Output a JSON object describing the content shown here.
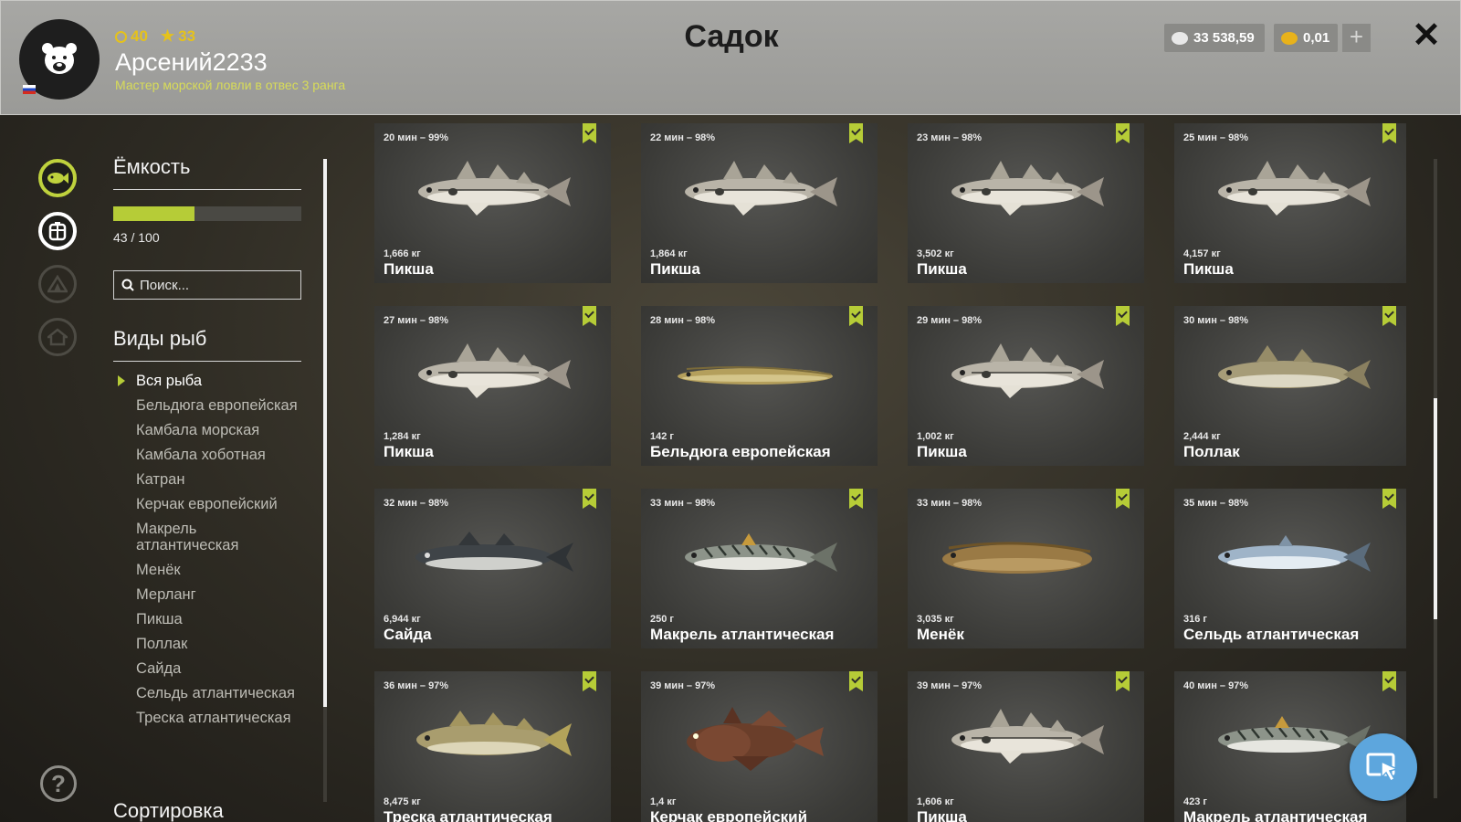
{
  "header": {
    "title": "Садок",
    "player": {
      "name": "Арсений2233",
      "level": "40",
      "rank_stars": "33",
      "rank_title": "Мастер морской ловли в отвес 3 ранга"
    },
    "currency": {
      "silver": "33 538,59",
      "gold": "0,01"
    },
    "plus_label": "+",
    "close_label": "✕"
  },
  "rail_icons": [
    "fish-icon",
    "keepnet-icon",
    "tent-icon",
    "home-icon",
    "help-icon"
  ],
  "sidebar": {
    "capacity_heading": "Ёмкость",
    "capacity_text": "43 / 100",
    "capacity_fraction": 0.43,
    "search_placeholder": "Поиск...",
    "species_heading": "Виды рыб",
    "species": [
      "Вся рыба",
      "Бельдюга европейская",
      "Камбала морская",
      "Камбала хоботная",
      "Катран",
      "Керчак европейский",
      "Макрель атлантическая",
      "Менёк",
      "Мерланг",
      "Пикша",
      "Поллак",
      "Сайда",
      "Сельдь атлантическая",
      "Треска атлантическая"
    ],
    "selected_species": "Вся рыба",
    "sort_heading": "Сортировка"
  },
  "fish": [
    {
      "time": "20 мин – 99%",
      "weight": "1,666 кг",
      "name": "Пикша",
      "kind": "haddock"
    },
    {
      "time": "22 мин – 98%",
      "weight": "1,864 кг",
      "name": "Пикша",
      "kind": "haddock"
    },
    {
      "time": "23 мин – 98%",
      "weight": "3,502 кг",
      "name": "Пикша",
      "kind": "haddock"
    },
    {
      "time": "25 мин – 98%",
      "weight": "4,157 кг",
      "name": "Пикша",
      "kind": "haddock"
    },
    {
      "time": "27 мин – 98%",
      "weight": "1,284 кг",
      "name": "Пикша",
      "kind": "haddock"
    },
    {
      "time": "28 мин – 98%",
      "weight": "142 г",
      "name": "Бельдюга европейская",
      "kind": "eelpout"
    },
    {
      "time": "29 мин – 98%",
      "weight": "1,002 кг",
      "name": "Пикша",
      "kind": "haddock"
    },
    {
      "time": "30 мин – 98%",
      "weight": "2,444 кг",
      "name": "Поллак",
      "kind": "pollack"
    },
    {
      "time": "32 мин – 98%",
      "weight": "6,944 кг",
      "name": "Сайда",
      "kind": "saithe"
    },
    {
      "time": "33 мин – 98%",
      "weight": "250 г",
      "name": "Макрель атлантическая",
      "kind": "mackerel"
    },
    {
      "time": "33 мин – 98%",
      "weight": "3,035 кг",
      "name": "Менёк",
      "kind": "tusk"
    },
    {
      "time": "35 мин – 98%",
      "weight": "316 г",
      "name": "Сельдь атлантическая",
      "kind": "herring"
    },
    {
      "time": "36 мин – 97%",
      "weight": "8,475 кг",
      "name": "Треска атлантическая",
      "kind": "cod"
    },
    {
      "time": "39 мин – 97%",
      "weight": "1,4 кг",
      "name": "Керчак европейский",
      "kind": "sculpin"
    },
    {
      "time": "39 мин – 97%",
      "weight": "1,606 кг",
      "name": "Пикша",
      "kind": "haddock"
    },
    {
      "time": "40 мин – 97%",
      "weight": "423 г",
      "name": "Макрель атлантическая",
      "kind": "mackerel"
    }
  ],
  "colors": {
    "accent_green": "#b6cc37",
    "header_bg": "#9f9f9c",
    "gold": "#e5c21b",
    "assist_blue": "#5da6dd"
  },
  "assist_button_icon": "cursor-icon"
}
